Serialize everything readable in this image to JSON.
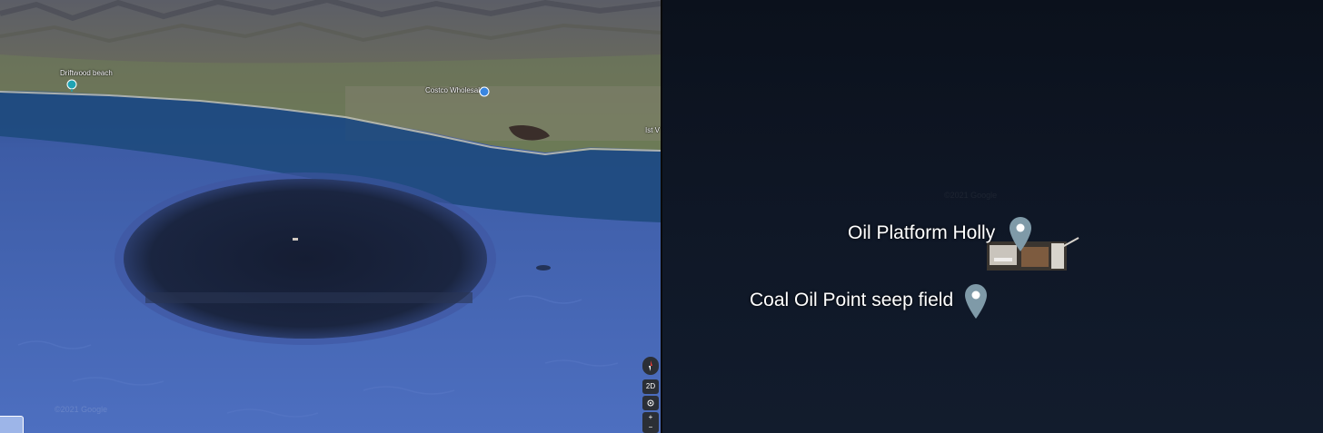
{
  "left_view": {
    "places": [
      {
        "label": "Driftwood beach",
        "icon": "beach-pin-icon",
        "color": "#1fa3b3"
      },
      {
        "label": "Costco Wholesale",
        "icon": "shopping-pin-icon",
        "color": "#3a86e0"
      },
      {
        "label": "Ist V"
      }
    ],
    "controls": {
      "mode_label": "2D",
      "zoom_out_label": "−",
      "zoom_in_label": "+"
    },
    "watermark": "©2021 Google"
  },
  "right_view": {
    "pins": [
      {
        "label": "Oil Platform Holly",
        "icon": "location-pin-icon",
        "color": "#7f9aa8"
      },
      {
        "label": "Coal Oil Point seep field",
        "icon": "location-pin-icon",
        "color": "#7f9aa8"
      }
    ],
    "watermark": "©2021 Google"
  },
  "colors": {
    "ocean": "#3f5fa6",
    "shore_water": "#1e4a7d",
    "dark_overlay": "#0d1420"
  }
}
